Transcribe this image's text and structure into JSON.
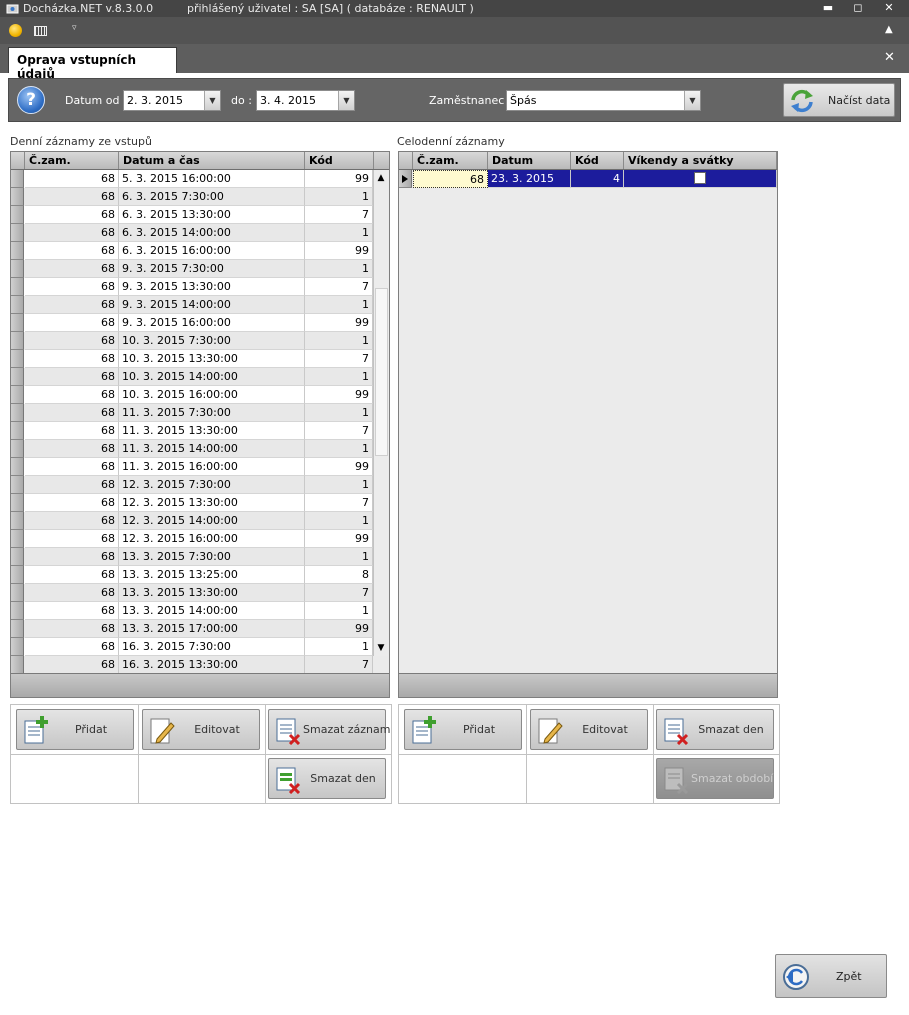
{
  "window": {
    "app_title": "Docházka.NET v.8.3.0.0",
    "user_info": "přihlášený uživatel : SA [SA] ( databáze : RENAULT )",
    "minimize_glyph": "▬",
    "maximize_glyph": "◻",
    "close_glyph": "✕"
  },
  "toolbar": {
    "dropdown_glyph": "▿",
    "collapse_glyph": "▲"
  },
  "tab": {
    "label": "Oprava vstupních údajů",
    "close_glyph": "✕"
  },
  "filter": {
    "help_glyph": "?",
    "date_from_label": "Datum od :",
    "date_from_value": "2. 3. 2015",
    "date_to_label": "do :",
    "date_to_value": "3. 4. 2015",
    "employee_label": "Zaměstnanec :",
    "employee_value": "Špás",
    "dropdown_glyph": "▼",
    "load_label": "Načíst data"
  },
  "daily": {
    "caption": "Denní záznamy ze vstupů",
    "columns": [
      "Č.zam.",
      "Datum a čas",
      "Kód"
    ],
    "scroll_up": "▲",
    "scroll_down": "▼",
    "rows": [
      {
        "emp": "68",
        "dt": "5. 3. 2015 16:00:00",
        "code": "99"
      },
      {
        "emp": "68",
        "dt": "6. 3. 2015 7:30:00",
        "code": "1"
      },
      {
        "emp": "68",
        "dt": "6. 3. 2015 13:30:00",
        "code": "7"
      },
      {
        "emp": "68",
        "dt": "6. 3. 2015 14:00:00",
        "code": "1"
      },
      {
        "emp": "68",
        "dt": "6. 3. 2015 16:00:00",
        "code": "99"
      },
      {
        "emp": "68",
        "dt": "9. 3. 2015 7:30:00",
        "code": "1"
      },
      {
        "emp": "68",
        "dt": "9. 3. 2015 13:30:00",
        "code": "7"
      },
      {
        "emp": "68",
        "dt": "9. 3. 2015 14:00:00",
        "code": "1"
      },
      {
        "emp": "68",
        "dt": "9. 3. 2015 16:00:00",
        "code": "99"
      },
      {
        "emp": "68",
        "dt": "10. 3. 2015 7:30:00",
        "code": "1"
      },
      {
        "emp": "68",
        "dt": "10. 3. 2015 13:30:00",
        "code": "7"
      },
      {
        "emp": "68",
        "dt": "10. 3. 2015 14:00:00",
        "code": "1"
      },
      {
        "emp": "68",
        "dt": "10. 3. 2015 16:00:00",
        "code": "99"
      },
      {
        "emp": "68",
        "dt": "11. 3. 2015 7:30:00",
        "code": "1"
      },
      {
        "emp": "68",
        "dt": "11. 3. 2015 13:30:00",
        "code": "7"
      },
      {
        "emp": "68",
        "dt": "11. 3. 2015 14:00:00",
        "code": "1"
      },
      {
        "emp": "68",
        "dt": "11. 3. 2015 16:00:00",
        "code": "99"
      },
      {
        "emp": "68",
        "dt": "12. 3. 2015 7:30:00",
        "code": "1"
      },
      {
        "emp": "68",
        "dt": "12. 3. 2015 13:30:00",
        "code": "7"
      },
      {
        "emp": "68",
        "dt": "12. 3. 2015 14:00:00",
        "code": "1"
      },
      {
        "emp": "68",
        "dt": "12. 3. 2015 16:00:00",
        "code": "99"
      },
      {
        "emp": "68",
        "dt": "13. 3. 2015 7:30:00",
        "code": "1"
      },
      {
        "emp": "68",
        "dt": "13. 3. 2015 13:25:00",
        "code": "8"
      },
      {
        "emp": "68",
        "dt": "13. 3. 2015 13:30:00",
        "code": "7"
      },
      {
        "emp": "68",
        "dt": "13. 3. 2015 14:00:00",
        "code": "1"
      },
      {
        "emp": "68",
        "dt": "13. 3. 2015 17:00:00",
        "code": "99"
      },
      {
        "emp": "68",
        "dt": "16. 3. 2015 7:30:00",
        "code": "1"
      },
      {
        "emp": "68",
        "dt": "16. 3. 2015 13:30:00",
        "code": "7"
      }
    ],
    "buttons": {
      "add": "Přidat",
      "edit": "Editovat",
      "delete_record": "Smazat záznam",
      "delete_day": "Smazat den"
    }
  },
  "allday": {
    "caption": "Celodenní záznamy",
    "columns": [
      "Č.zam.",
      "Datum",
      "Kód",
      "Víkendy a svátky"
    ],
    "rows": [
      {
        "emp": "68",
        "date": "23. 3. 2015",
        "code": "4",
        "weekend": false
      }
    ],
    "buttons": {
      "add": "Přidat",
      "edit": "Editovat",
      "delete_day": "Smazat den",
      "delete_period": "Smazat období"
    }
  },
  "back": {
    "label": "Zpět"
  },
  "colors": {
    "selection": "#1c1c9c",
    "current_cell": "#fffbd0",
    "row_alt": "#e8e8e8"
  }
}
